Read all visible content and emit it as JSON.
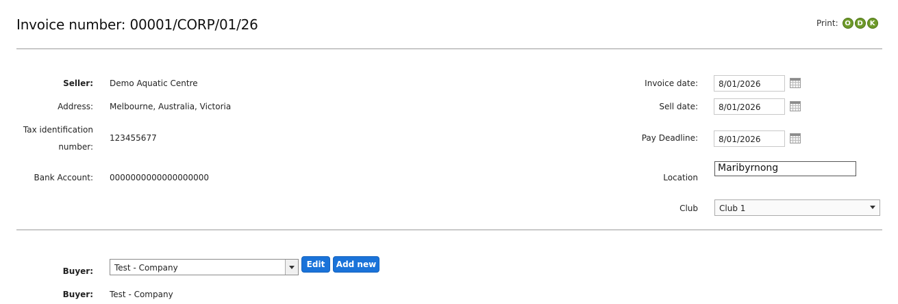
{
  "header": {
    "title": "Invoice number: 00001/CORP/01/26",
    "print_label": "Print:",
    "print_buttons": [
      "O",
      "D",
      "K"
    ]
  },
  "seller": {
    "seller_label": "Seller:",
    "seller_value": "Demo Aquatic Centre",
    "address_label": "Address:",
    "address_value": "Melbourne, Australia, Victoria",
    "tax_label_line1": "Tax identification",
    "tax_label_line2": "number:",
    "tax_value": "123455677",
    "bank_label": "Bank Account:",
    "bank_value": "0000000000000000000"
  },
  "invoice": {
    "invoice_date_label": "Invoice date:",
    "invoice_date_value": "8/01/2026",
    "sell_date_label": "Sell date:",
    "sell_date_value": "8/01/2026",
    "pay_deadline_label": "Pay Deadline:",
    "pay_deadline_value": "8/01/2026",
    "location_label": "Location",
    "location_value": "Maribyrnong",
    "club_label": "Club",
    "club_value": "Club 1"
  },
  "buyer": {
    "buyer_label": "Buyer:",
    "buyer_select_value": "Test - Company",
    "edit_label": "Edit",
    "add_new_label": "Add new",
    "buyer_label2": "Buyer:",
    "buyer_value": "Test - Company"
  },
  "colors": {
    "print_button": "#6e9a2a",
    "action_button": "#1a73d9",
    "divider": "#9a9a9a"
  }
}
